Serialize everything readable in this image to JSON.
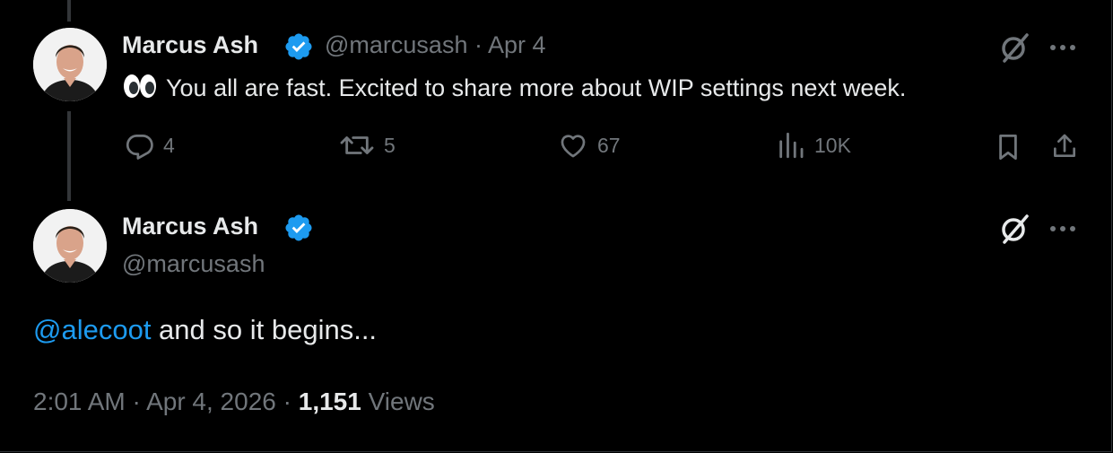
{
  "reply_tweet": {
    "author_name": "Marcus Ash",
    "handle": "@marcusash",
    "separator": "·",
    "date": "Apr 4",
    "text": "You all are fast. Excited to share more about WIP settings next week.",
    "emoji_icon": "eyes-emoji",
    "actions": {
      "replies": "4",
      "reposts": "5",
      "likes": "67",
      "views": "10K"
    }
  },
  "main_tweet": {
    "author_name": "Marcus Ash",
    "handle": "@marcusash",
    "mention": "@alecoot",
    "text_rest": " and so it begins...",
    "time": "2:01 AM",
    "separator": "·",
    "date": "Apr 4, 2026",
    "views_count": "1,151",
    "views_label": "Views"
  },
  "colors": {
    "background": "#000000",
    "text_primary": "#e7e9ea",
    "text_secondary": "#71767b",
    "accent": "#1d9bf0",
    "verified": "#1d9bf0"
  }
}
